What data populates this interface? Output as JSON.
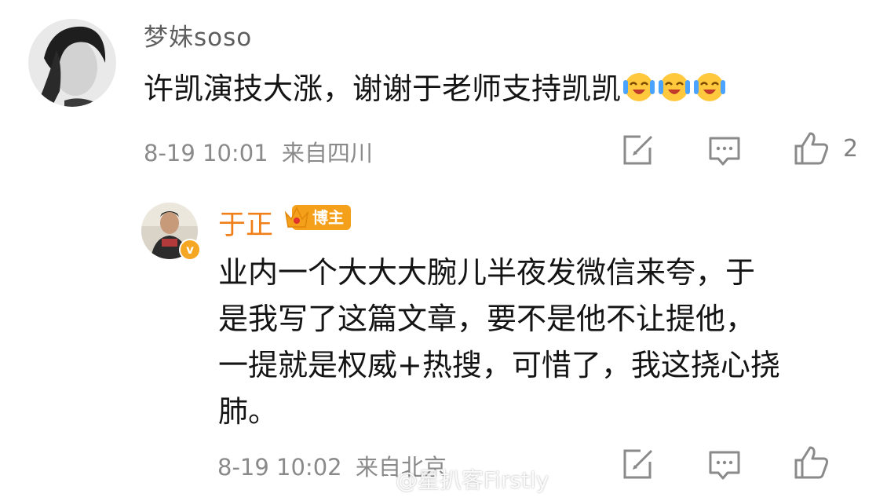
{
  "comment": {
    "username": "梦妹soso",
    "text": "许凯演技大涨，谢谢于老师支持凯凯",
    "emojis": [
      "laugh-cry-emoji",
      "laugh-cry-emoji",
      "laugh-cry-emoji"
    ],
    "time": "8-19 10:01",
    "location": "来自四川",
    "likes": "2"
  },
  "reply": {
    "username": "于正",
    "verified_badge": "v",
    "role_badge": "博主",
    "lines": [
      "业内一个大大大腕儿半夜发微信来夸，于",
      "是我写了这篇文章，要不是他不让提他，",
      "一提就是权威+热搜，可惜了，我这挠心挠",
      "肺。"
    ],
    "time": "8-19 10:02",
    "location": "来自北京"
  },
  "watermark": "@星扒客Firstly",
  "colors": {
    "username_gray": "#5e5e5e",
    "blogger_orange": "#f07f19",
    "badge_gold": "#f5a01a",
    "meta_gray": "#8a8a8a"
  }
}
